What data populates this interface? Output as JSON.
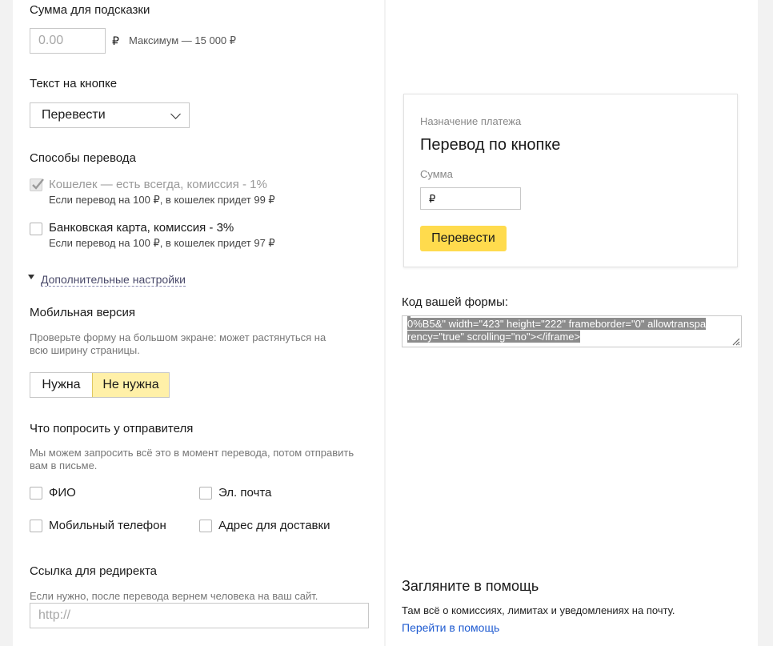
{
  "tip": {
    "label": "Сумма для подсказки",
    "placeholder": "0.00",
    "currency": "₽",
    "max_text": "Максимум — 15 000 ₽"
  },
  "button_text": {
    "label": "Текст на кнопке",
    "selected": "Перевести"
  },
  "methods": {
    "label": "Способы перевода",
    "wallet": {
      "title": "Кошелек — есть всегда, комиссия - 1%",
      "note": "Если перевод на 100 ₽, в кошелек придет 99 ₽",
      "checked": true,
      "disabled": true
    },
    "card": {
      "title": "Банковская карта, комиссия - 3%",
      "note": "Если перевод на 100 ₽, в кошелек придет 97 ₽",
      "checked": false
    }
  },
  "advanced_link": "Дополнительные настройки",
  "mobile": {
    "label": "Мобильная версия",
    "hint_line1": "Проверьте форму на большом экране: может растянуться на",
    "hint_line2": "всю ширину страницы.",
    "options": [
      "Нужна",
      "Не нужна"
    ],
    "selected": "Не нужна"
  },
  "ask": {
    "label": "Что попросить у отправителя",
    "hint_line1": "Мы можем запросить всё это в момент перевода, потом отправить",
    "hint_line2": "вам в письме.",
    "fio": "ФИО",
    "email": "Эл. почта",
    "phone": "Мобильный телефон",
    "address": "Адрес для доставки"
  },
  "redirect": {
    "label": "Ссылка для редиректа",
    "hint": "Если нужно, после перевода вернем человека на ваш сайт.",
    "placeholder": "http://"
  },
  "preview": {
    "purpose_label": "Назначение платежа",
    "purpose_title": "Перевод по кнопке",
    "amount_label": "Сумма",
    "currency": "₽",
    "button": "Перевести"
  },
  "code": {
    "label": "Код вашей формы:",
    "line1": "0%B5&\" width=\"423\" height=\"222\" frameborder=\"0\" allowtranspa",
    "line2": "rency=\"true\" scrolling=\"no\"></iframe>"
  },
  "help": {
    "title": "Загляните в помощь",
    "text": "Там всё о комиссиях, лимитах и уведомлениях на почту.",
    "link": "Перейти в помощь"
  },
  "colors": {
    "accent_yellow": "#ffdb4d",
    "link_blue": "#1f5bd1",
    "toggle_selected": "#fff0a8"
  }
}
